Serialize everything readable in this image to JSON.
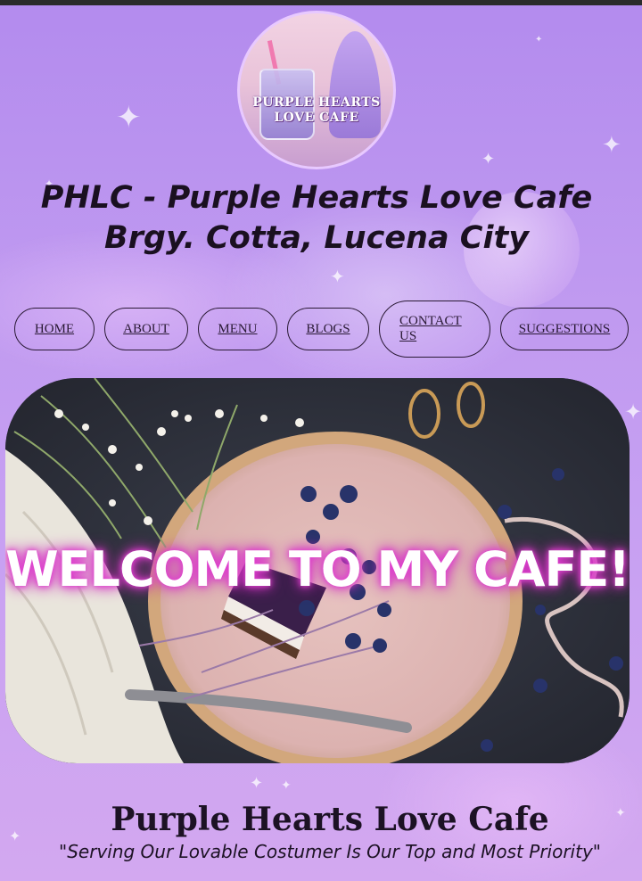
{
  "site": {
    "title_line1": "PHLC - Purple Hearts Love Cafe",
    "title_line2": "Brgy. Cotta, Lucena City",
    "logo_text": "PURPLE HEARTS LOVE CAFE",
    "logo_icon": "cafe-logo"
  },
  "nav": {
    "items": [
      {
        "label": "HOME"
      },
      {
        "label": "ABOUT"
      },
      {
        "label": "MENU"
      },
      {
        "label": "BLOGS"
      },
      {
        "label": "CONTACT US"
      },
      {
        "label": "SUGGESTIONS"
      }
    ]
  },
  "hero": {
    "heading": "WELCOME TO MY CAFE!",
    "image_subject": "blueberry-cheesecake-photo"
  },
  "footer_section": {
    "brand_name": "Purple Hearts Love Cafe",
    "tagline": "\"Serving Our Lovable Costumer Is Our Top and Most Priority\""
  },
  "colors": {
    "background": "#c09af0",
    "topbar": "#2b2b2b",
    "heading_glow": "#e040d0",
    "text": "#1a1020"
  }
}
